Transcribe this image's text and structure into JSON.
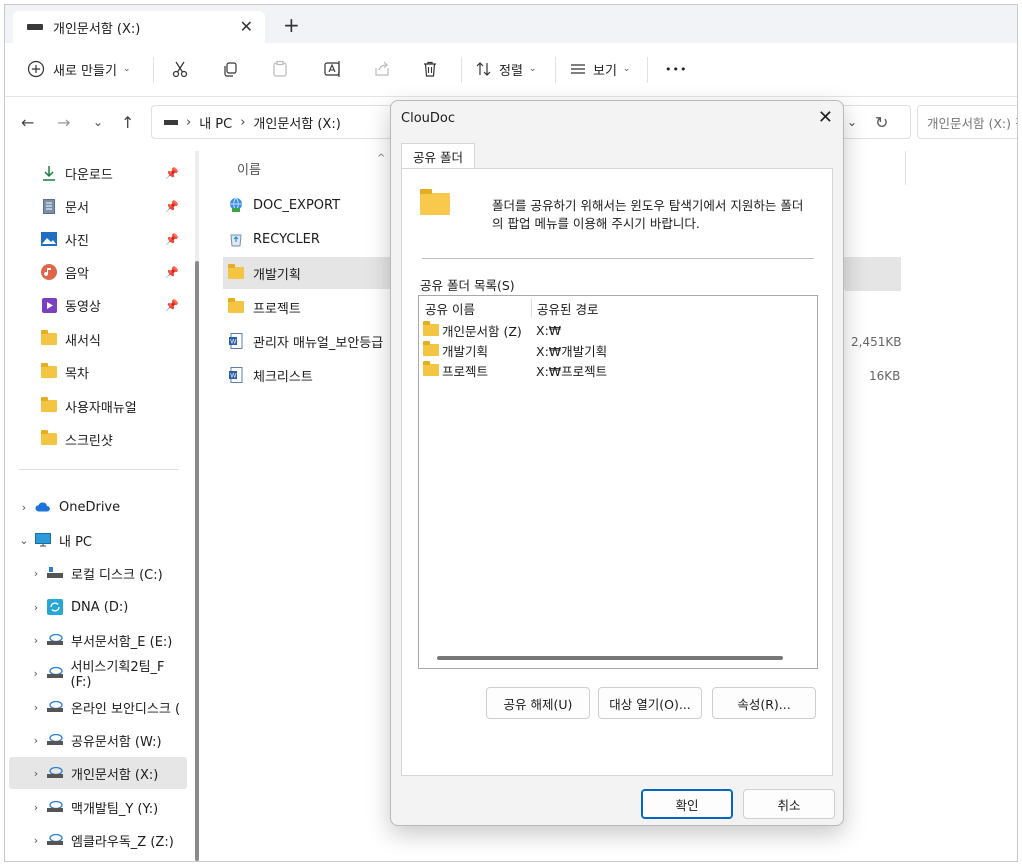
{
  "tab": {
    "title": "개인문서함 (X:)",
    "close": "✕",
    "new_tab": "+"
  },
  "toolbar": {
    "new_label": "새로 만들기",
    "sort_label": "정렬",
    "view_label": "보기",
    "more_label": "•••"
  },
  "address": {
    "segments": [
      "내 PC",
      "개인문서함 (X:)"
    ],
    "search_placeholder": "개인문서함 (X:) 검"
  },
  "sidebar": {
    "quick": [
      {
        "label": "다운로드",
        "icon": "download-icon",
        "pinned": true
      },
      {
        "label": "문서",
        "icon": "document-icon",
        "pinned": true
      },
      {
        "label": "사진",
        "icon": "picture-icon",
        "pinned": true
      },
      {
        "label": "음악",
        "icon": "music-icon",
        "pinned": true
      },
      {
        "label": "동영상",
        "icon": "video-icon",
        "pinned": true
      },
      {
        "label": "새서식",
        "icon": "folder-icon"
      },
      {
        "label": "목차",
        "icon": "folder-icon"
      },
      {
        "label": "사용자매뉴얼",
        "icon": "folder-icon"
      },
      {
        "label": "스크린샷",
        "icon": "folder-icon"
      }
    ],
    "tree": [
      {
        "label": "OneDrive",
        "icon": "cloud-icon"
      },
      {
        "label": "내 PC",
        "icon": "monitor-icon"
      },
      {
        "label": "로컬 디스크 (C:)",
        "icon": "drive-icon"
      },
      {
        "label": "DNA (D:)",
        "icon": "sync-drive-icon"
      },
      {
        "label": "부서문서함_E (E:)",
        "icon": "network-drive-icon"
      },
      {
        "label": "서비스기획2팀_F (F:)",
        "icon": "network-drive-icon"
      },
      {
        "label": "온라인 보안디스크 (",
        "icon": "network-drive-icon"
      },
      {
        "label": "공유문서함 (W:)",
        "icon": "network-drive-icon"
      },
      {
        "label": "개인문서함 (X:)",
        "icon": "network-drive-icon",
        "selected": true
      },
      {
        "label": "맥개발팀_Y (Y:)",
        "icon": "network-drive-icon"
      },
      {
        "label": "엠클라우독_Z (Z:)",
        "icon": "network-drive-icon"
      }
    ]
  },
  "content": {
    "col_name": "이름",
    "files": [
      {
        "name": "DOC_EXPORT",
        "icon": "globe-folder-icon"
      },
      {
        "name": "RECYCLER",
        "icon": "recycle-icon"
      },
      {
        "name": "개발기획",
        "icon": "folder-icon",
        "selected": true
      },
      {
        "name": "프로젝트",
        "icon": "folder-icon"
      },
      {
        "name": "관리자 매뉴얼_보안등급",
        "icon": "word-doc-icon",
        "size": "2,451KB"
      },
      {
        "name": "체크리스트",
        "icon": "word-doc-icon",
        "size": "16KB"
      }
    ]
  },
  "dialog": {
    "title": "ClouDoc",
    "close": "✕",
    "tab_label": "공유 폴더",
    "message": "폴더를 공유하기 위해서는 윈도우 탐색기에서 지원하는 폴더의 팝업 메뉴를 이용해 주시기 바랍니다.",
    "list_label": "공유 폴더 목록(S)",
    "list_headers": [
      "공유 이름",
      "공유된 경로"
    ],
    "list_rows": [
      {
        "name": "개인문서함 (Z)",
        "path": "X:₩"
      },
      {
        "name": "개발기획",
        "path": "X:₩개발기획"
      },
      {
        "name": "프로젝트",
        "path": "X:₩프로젝트"
      }
    ],
    "btn_unshare": "공유 해제(U)",
    "btn_open": "대상 열기(O)...",
    "btn_props": "속성(R)...",
    "btn_ok": "확인",
    "btn_cancel": "취소"
  },
  "colors": {
    "folder": "#f4c542",
    "accent": "#0067c0",
    "selection": "#e5e5e5"
  }
}
